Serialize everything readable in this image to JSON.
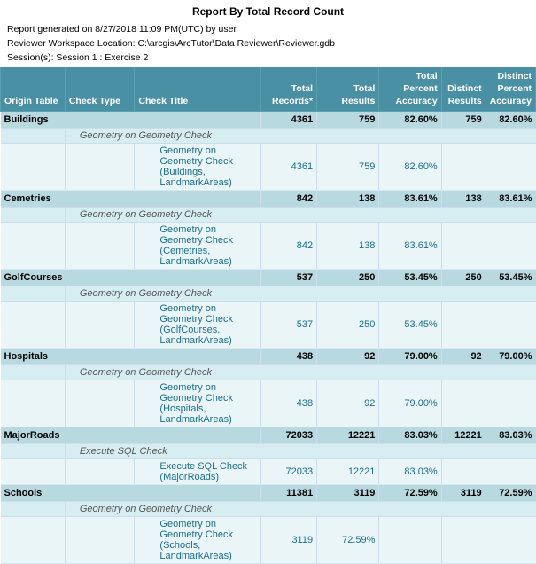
{
  "title": "Report By Total Record Count",
  "meta": {
    "line1": "Report generated on 8/27/2018 11:09 PM(UTC) by user",
    "line2": "Reviewer Workspace Location: C:\\arcgis\\ArcTutor\\Data Reviewer\\Reviewer.gdb",
    "line3": "Session(s): Session 1 : Exercise 2"
  },
  "headers": {
    "origin": "Origin Table",
    "checkType": "Check Type",
    "checkTitle": "Check Title",
    "totalRecords": "Total Records*",
    "totalResults": "Total Results",
    "totalPctAcc": "Total Percent Accuracy",
    "distinctResults": "Distinct Results",
    "distinctPctAcc": "Distinct Percent Accuracy"
  },
  "groups": [
    {
      "origin": "Buildings",
      "totalRecords": "4361",
      "totalResults": "759",
      "totalPctAcc": "82.60%",
      "distinctResults": "759",
      "distinctPctAcc": "82.60%",
      "checkTypes": [
        {
          "name": "Geometry on Geometry Check",
          "titles": [
            {
              "name": "Geometry on Geometry Check (Buildings, LandmarkAreas)",
              "totalRecords": "4361",
              "totalResults": "759",
              "totalPctAcc": "82.60%",
              "distinctResults": "",
              "distinctPctAcc": ""
            }
          ]
        }
      ]
    },
    {
      "origin": "Cemetries",
      "totalRecords": "842",
      "totalResults": "138",
      "totalPctAcc": "83.61%",
      "distinctResults": "138",
      "distinctPctAcc": "83.61%",
      "checkTypes": [
        {
          "name": "Geometry on Geometry Check",
          "titles": [
            {
              "name": "Geometry on Geometry Check (Cemetries, LandmarkAreas)",
              "totalRecords": "842",
              "totalResults": "138",
              "totalPctAcc": "83.61%",
              "distinctResults": "",
              "distinctPctAcc": ""
            }
          ]
        }
      ]
    },
    {
      "origin": "GolfCourses",
      "totalRecords": "537",
      "totalResults": "250",
      "totalPctAcc": "53.45%",
      "distinctResults": "250",
      "distinctPctAcc": "53.45%",
      "checkTypes": [
        {
          "name": "Geometry on Geometry Check",
          "titles": [
            {
              "name": "Geometry on Geometry Check (GolfCourses, LandmarkAreas)",
              "totalRecords": "537",
              "totalResults": "250",
              "totalPctAcc": "53.45%",
              "distinctResults": "",
              "distinctPctAcc": ""
            }
          ]
        }
      ]
    },
    {
      "origin": "Hospitals",
      "totalRecords": "438",
      "totalResults": "92",
      "totalPctAcc": "79.00%",
      "distinctResults": "92",
      "distinctPctAcc": "79.00%",
      "checkTypes": [
        {
          "name": "Geometry on Geometry Check",
          "titles": [
            {
              "name": "Geometry on Geometry Check (Hospitals, LandmarkAreas)",
              "totalRecords": "438",
              "totalResults": "92",
              "totalPctAcc": "79.00%",
              "distinctResults": "",
              "distinctPctAcc": ""
            }
          ]
        }
      ]
    },
    {
      "origin": "MajorRoads",
      "totalRecords": "72033",
      "totalResults": "12221",
      "totalPctAcc": "83.03%",
      "distinctResults": "12221",
      "distinctPctAcc": "83.03%",
      "checkTypes": [
        {
          "name": "Execute SQL Check",
          "titles": [
            {
              "name": "Execute SQL Check (MajorRoads)",
              "totalRecords": "72033",
              "totalResults": "12221",
              "totalPctAcc": "83.03%",
              "distinctResults": "",
              "distinctPctAcc": ""
            }
          ]
        }
      ]
    },
    {
      "origin": "Schools",
      "totalRecords": "11381",
      "totalResults": "3119",
      "totalPctAcc": "72.59%",
      "distinctResults": "3119",
      "distinctPctAcc": "72.59%",
      "checkTypes": [
        {
          "name": "Geometry on Geometry Check",
          "titles": [
            {
              "name": "Geometry on Geometry Check (Schools, LandmarkAreas)",
              "totalRecords": "3119",
              "totalResults": "72.59%",
              "totalPctAcc": "",
              "distinctResults": "",
              "distinctPctAcc": ""
            }
          ]
        }
      ]
    }
  ]
}
